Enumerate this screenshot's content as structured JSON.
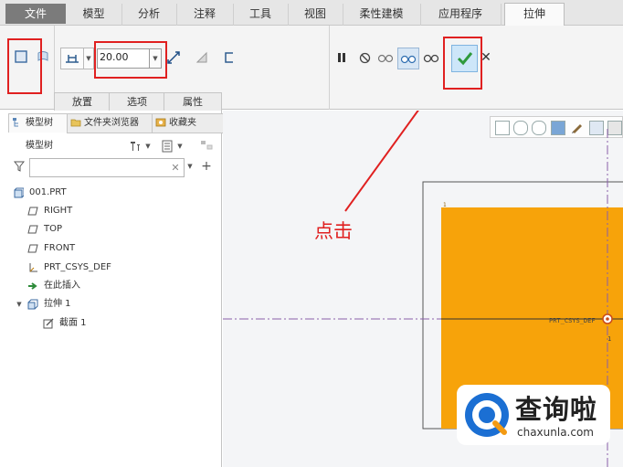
{
  "ribbon_tabs": [
    {
      "label": "文件"
    },
    {
      "label": "模型"
    },
    {
      "label": "分析"
    },
    {
      "label": "注释"
    },
    {
      "label": "工具"
    },
    {
      "label": "视图"
    },
    {
      "label": "柔性建模"
    },
    {
      "label": "应用程序"
    },
    {
      "label": "拉伸"
    }
  ],
  "toolbar": {
    "depth_value": "20.00",
    "subtabs": [
      {
        "label": "放置"
      },
      {
        "label": "选项"
      },
      {
        "label": "属性"
      }
    ]
  },
  "panel_tabs": [
    {
      "label": "模型树"
    },
    {
      "label": "文件夹浏览器"
    },
    {
      "label": "收藏夹"
    }
  ],
  "model_tree": {
    "title": "模型树",
    "filter_placeholder": "",
    "items": [
      {
        "label": "001.PRT"
      },
      {
        "label": "RIGHT"
      },
      {
        "label": "TOP"
      },
      {
        "label": "FRONT"
      },
      {
        "label": "PRT_CSYS_DEF"
      },
      {
        "label": "在此插入"
      },
      {
        "label": "拉伸 1"
      },
      {
        "label": "截面 1"
      }
    ]
  },
  "graphics": {
    "csys_label": "PRT_CSYS_DEF",
    "corner_label": "1",
    "small_label": "1",
    "fill_color": "#f7a30a"
  },
  "annotation": {
    "text": "点击",
    "color": "#e02020"
  },
  "watermark": {
    "title": "查询啦",
    "url": "chaxunla.com"
  }
}
